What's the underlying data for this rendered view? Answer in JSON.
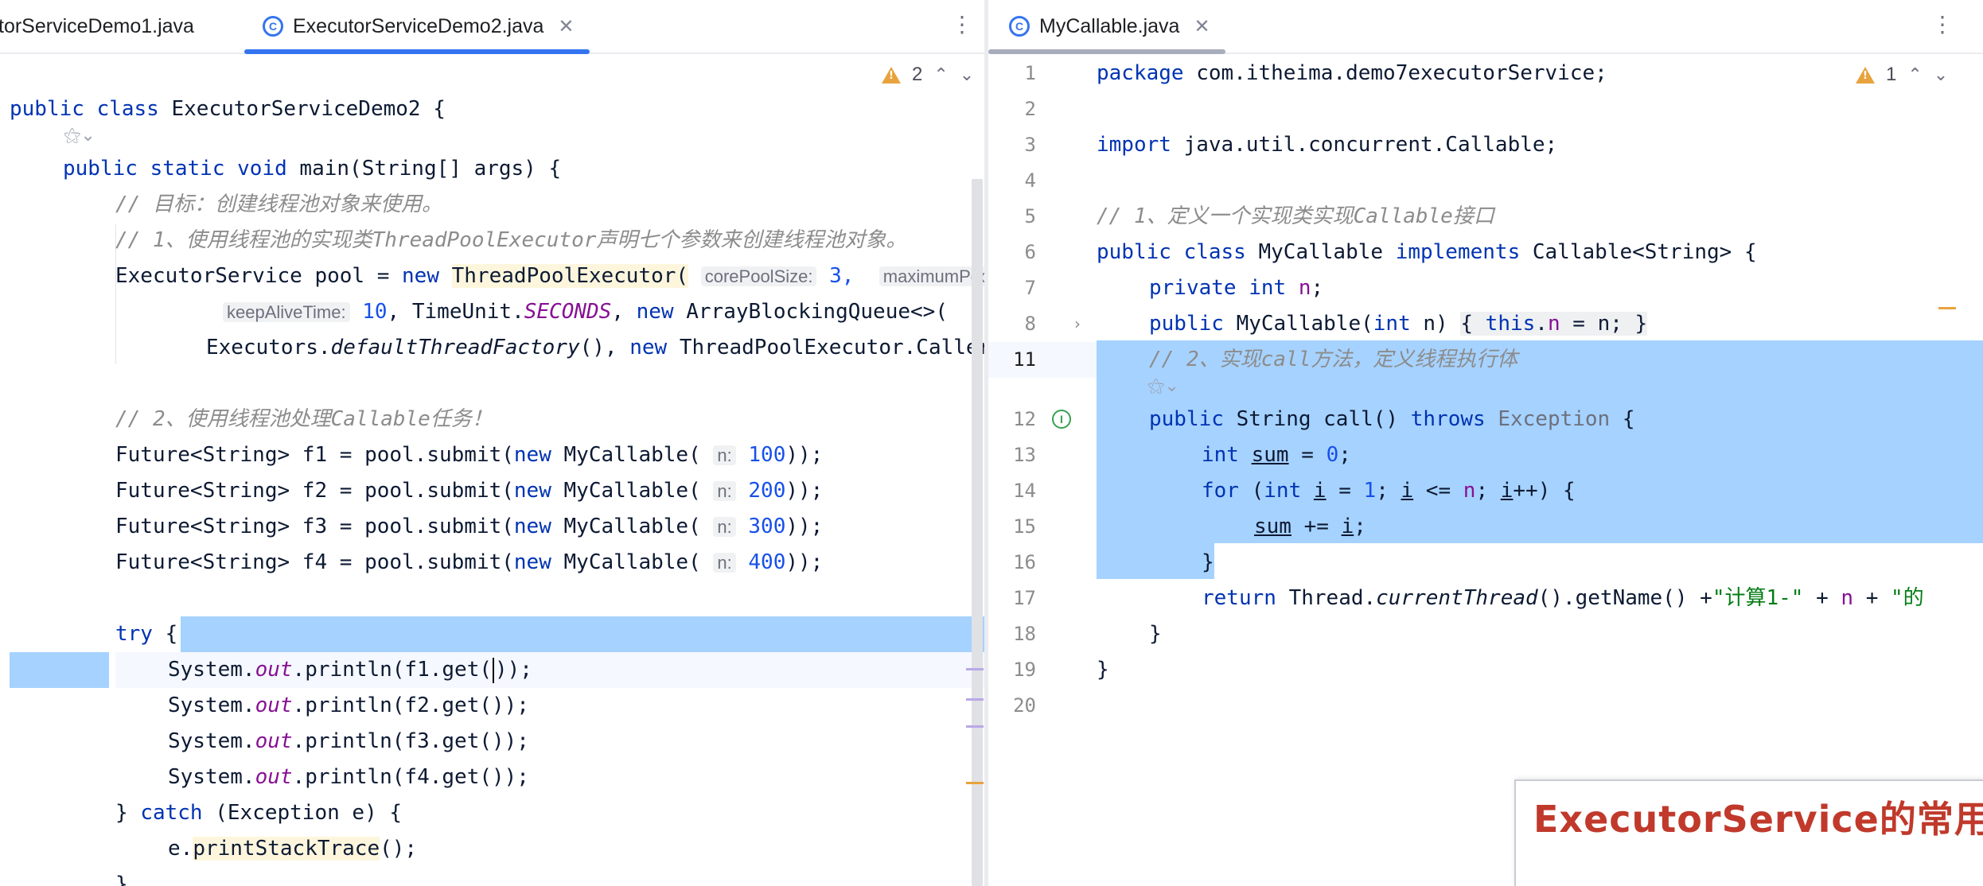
{
  "left_editor": {
    "tabs": [
      {
        "label": "torServiceDemo1.java"
      },
      {
        "label": "ExecutorServiceDemo2.java",
        "active": true
      }
    ],
    "inspection_count": "2",
    "code": {
      "l1_a": "public class ",
      "l1_b": "ExecutorServiceDemo2 {",
      "l2_a": "public static void ",
      "l2_b": "main(String[] args) {",
      "l3": "// 目标：创建线程池对象来使用。",
      "l4": "// 1、使用线程池的实现类ThreadPoolExecutor声明七个参数来创建线程池对象。",
      "l5_a": "ExecutorService pool = ",
      "l5_b": "new ",
      "l5_c": "ThreadPoolExecutor(",
      "l5_hint1": "corePoolSize:",
      "l5_d": " 3,",
      "l5_hint2": "maximumPoolSize:",
      "l6_hint": "keepAliveTime:",
      "l6_a": " 10",
      "l6_b": ", TimeUnit.",
      "l6_c": "SECONDS",
      "l6_d": ", ",
      "l6_e": "new ",
      "l6_f": "ArrayBlockingQueue<>(",
      "l7_a": "Executors.",
      "l7_b": "defaultThreadFactory",
      "l7_c": "(), ",
      "l7_d": "new ",
      "l7_e": "ThreadPoolExecutor.CallerRunsPolicy());",
      "l9": "// 2、使用线程池处理Callable任务！",
      "f_lines": [
        {
          "a": "Future<String> f1 = pool.submit(",
          "b": "new ",
          "c": "MyCallable(",
          "hint": "n:",
          "num": " 100",
          "d": "));"
        },
        {
          "a": "Future<String> f2 = pool.submit(",
          "b": "new ",
          "c": "MyCallable(",
          "hint": "n:",
          "num": " 200",
          "d": "));"
        },
        {
          "a": "Future<String> f3 = pool.submit(",
          "b": "new ",
          "c": "MyCallable(",
          "hint": "n:",
          "num": " 300",
          "d": "));"
        },
        {
          "a": "Future<String> f4 = pool.submit(",
          "b": "new ",
          "c": "MyCallable(",
          "hint": "n:",
          "num": " 400",
          "d": "));"
        }
      ],
      "try_a": "try ",
      "try_b": "{",
      "print_lines": [
        {
          "a": "System.",
          "b": "out",
          "c": ".println(f1.get(",
          "d": "));"
        },
        {
          "a": "System.",
          "b": "out",
          "c": ".println(f2.get());"
        },
        {
          "a": "System.",
          "b": "out",
          "c": ".println(f3.get());"
        },
        {
          "a": "System.",
          "b": "out",
          "c": ".println(f4.get());"
        }
      ],
      "catch_a": "} ",
      "catch_b": "catch ",
      "catch_c": "(Exception e) {",
      "stack_a": "e.",
      "stack_b": "printStackTrace",
      "stack_c": "();",
      "close": "}"
    }
  },
  "right_editor": {
    "tabs": [
      {
        "label": "MyCallable.java",
        "active": true
      }
    ],
    "inspection_count": "1",
    "line_numbers": [
      "1",
      "2",
      "3",
      "4",
      "5",
      "6",
      "7",
      "8",
      "11",
      "12",
      "13",
      "14",
      "15",
      "16",
      "17",
      "18",
      "19",
      "20"
    ],
    "code": {
      "l1_a": "package ",
      "l1_b": "com.itheima.demo7executorService;",
      "l3_a": "import ",
      "l3_b": "java.util.concurrent.Callable;",
      "l5": "// 1、定义一个实现类实现Callable接口",
      "l6_a": "public class ",
      "l6_b": "MyCallable ",
      "l6_c": "implements ",
      "l6_d": "Callable<String> {",
      "l7_a": "private int ",
      "l7_b": "n",
      "l7_c": ";",
      "l8_a": "public ",
      "l8_b": "MyCallable(",
      "l8_c": "int ",
      "l8_d": "n) ",
      "l8_e": "{ ",
      "l8_f": "this",
      "l8_g": ".",
      "l8_h": "n",
      "l8_i": " = n; ",
      "l8_j": "}",
      "l11": "// 2、实现call方法，定义线程执行体",
      "l12_a": "public ",
      "l12_b": "String ",
      "l12_c": "call",
      "l12_d": "() ",
      "l12_e": "throws ",
      "l12_f": "Exception",
      "l12_g": " {",
      "l13_a": "int ",
      "l13_b": "sum",
      "l13_c": " = ",
      "l13_d": "0",
      "l13_e": ";",
      "l14_a": "for ",
      "l14_b": "(",
      "l14_c": "int ",
      "l14_d": "i",
      "l14_e": " = ",
      "l14_f": "1",
      "l14_g": "; ",
      "l14_h": "i",
      "l14_i": " <= ",
      "l14_j": "n",
      "l14_k": "; ",
      "l14_l": "i",
      "l14_m": "++) {",
      "l15_a": "sum",
      "l15_b": " += ",
      "l15_c": "i",
      "l15_d": ";",
      "l16": "}",
      "l17_a": "return ",
      "l17_b": "Thread.",
      "l17_c": "currentThread",
      "l17_d": "().getName() +",
      "l17_e": "\"计算1-\"",
      "l17_f": " + ",
      "l17_g": "n",
      "l17_h": " + ",
      "l17_i": "\"的",
      "l18": "}",
      "l19": "}"
    }
  },
  "banner": {
    "text": "ExecutorService的常用"
  },
  "colors": {
    "keyword": "#0033b3",
    "comment": "#8c8c8c",
    "string": "#067d17",
    "number": "#1750eb",
    "field": "#871094",
    "selection": "#a6d2ff",
    "accent": "#3574f0",
    "banner_text": "#c0392b"
  }
}
